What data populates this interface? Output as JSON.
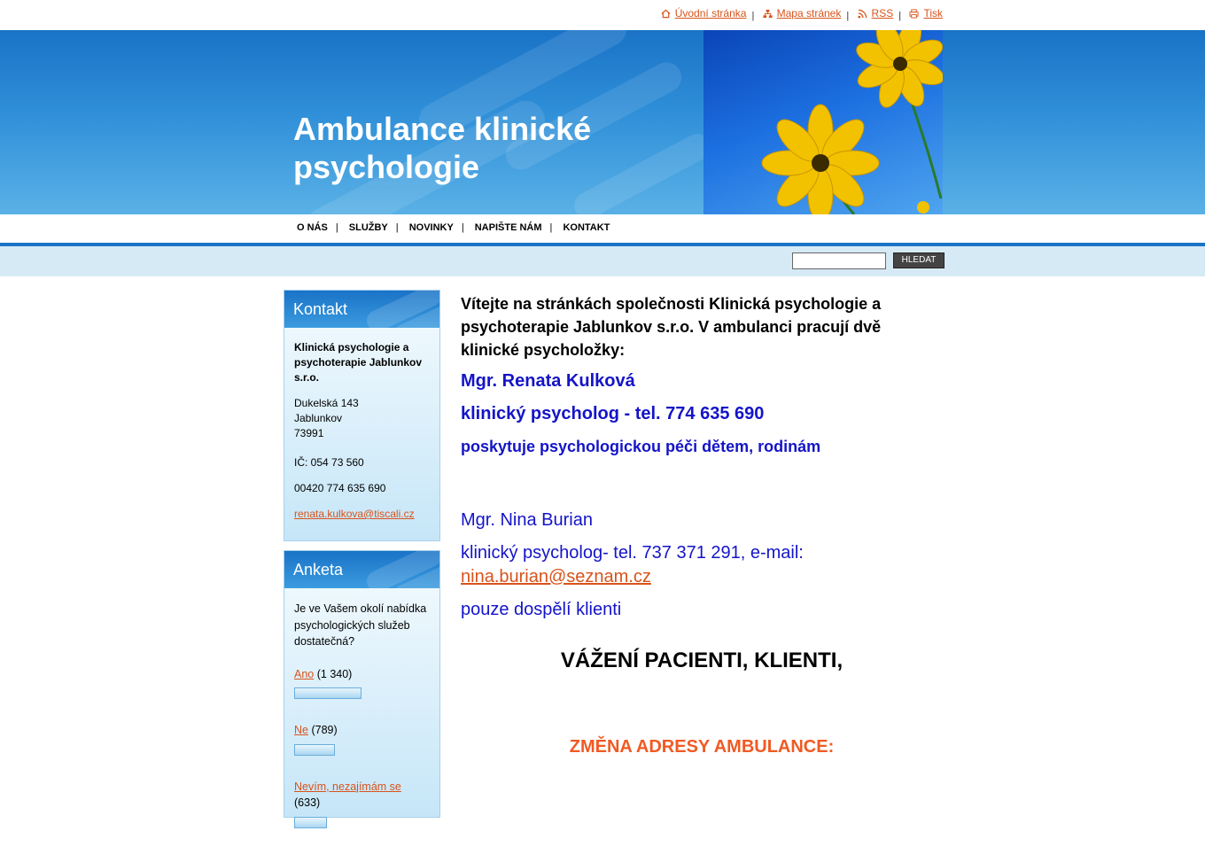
{
  "toplinks": [
    {
      "label": "Úvodní stránka",
      "icon": "home-icon"
    },
    {
      "label": "Mapa stránek",
      "icon": "sitemap-icon"
    },
    {
      "label": "RSS",
      "icon": "rss-icon"
    },
    {
      "label": "Tisk",
      "icon": "print-icon"
    }
  ],
  "header": {
    "title": "Ambulance klinické psychologie"
  },
  "nav": [
    "O NÁS",
    "SLUŽBY",
    "NOVINKY",
    "NAPIŠTE NÁM",
    "KONTAKT"
  ],
  "search": {
    "button": "HLEDAT",
    "value": ""
  },
  "contact_box": {
    "title": "Kontakt",
    "company": "Klinická psychologie a psychoterapie Jablunkov s.r.o.",
    "street": "Dukelská 143",
    "city": "Jablunkov",
    "zip": "73991",
    "ic": "IČ: 054 73 560",
    "phone": "00420 774 635 690",
    "email": "renata.kulkova@tiscali.cz"
  },
  "poll_box": {
    "title": "Anketa",
    "question": "Je ve Vašem okolí nabídka psychologických služeb dostatečná?",
    "options": [
      {
        "label": "Ano",
        "count": "(1 340)",
        "share": 0.48
      },
      {
        "label": "Ne",
        "count": "(789)",
        "share": 0.28
      },
      {
        "label": "Nevím, nezajímám se",
        "count": "(633)",
        "share": 0.23
      }
    ]
  },
  "content": {
    "intro": "Vítejte na stránkách společnosti Klinická psychologie a psychoterapie Jablunkov s.r.o. V ambulanci pracují dvě klinické psycholožky:",
    "p1_name": "Mgr. Renata Kulková",
    "p1_role": "klinický psycholog - tel. 774 635 690",
    "p1_note": "poskytuje psychologickou péči dětem, rodinám",
    "p2_name": "Mgr. Nina Burian",
    "p2_role": "klinický psycholog- tel. 737 371 291, e-mail:",
    "p2_email": "nina.burian@seznam.cz",
    "p2_note": "pouze dospělí klienti",
    "greeting": "VÁŽENÍ PACIENTI, KLIENTI,",
    "notice": "ZMĚNA ADRESY AMBULANCE:"
  },
  "colors": {
    "brand_blue": "#1a73c7",
    "link_orange": "#d8531b",
    "text_blue": "#1414c8",
    "notice_orange": "#f05a23"
  }
}
